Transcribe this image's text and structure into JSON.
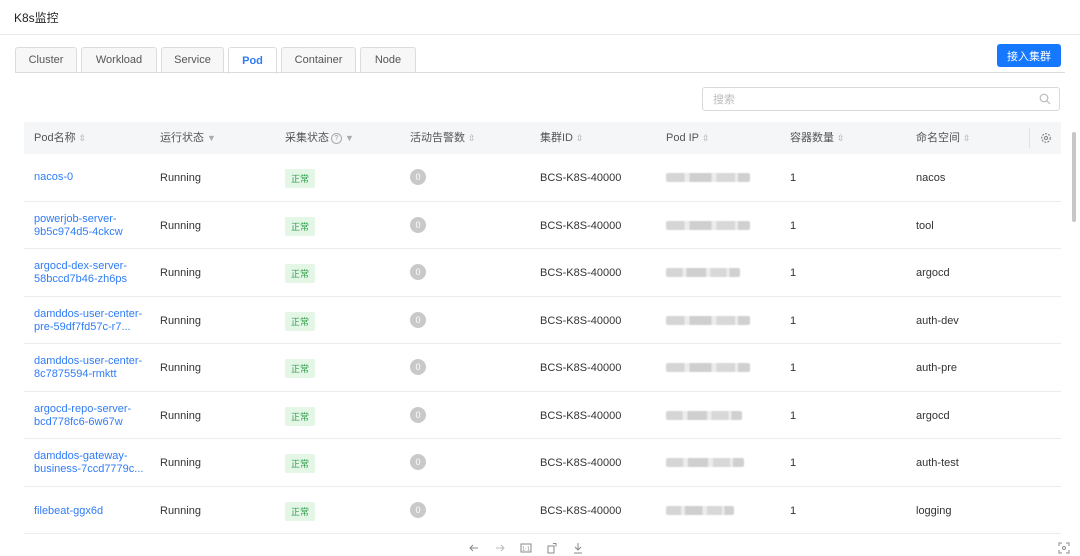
{
  "app": {
    "title": "K8s监控"
  },
  "tabs": [
    {
      "label": "Cluster",
      "active": false
    },
    {
      "label": "Workload",
      "active": false
    },
    {
      "label": "Service",
      "active": false
    },
    {
      "label": "Pod",
      "active": true
    },
    {
      "label": "Container",
      "active": false
    },
    {
      "label": "Node",
      "active": false
    }
  ],
  "actions": {
    "connect_cluster_label": "接入集群"
  },
  "search": {
    "placeholder": "搜索",
    "value": ""
  },
  "table": {
    "columns": {
      "pod_name": "Pod名称",
      "run_status": "运行状态",
      "collect_status": "采集状态",
      "active_alarms": "活动告警数",
      "cluster_id": "集群ID",
      "pod_ip": "Pod IP",
      "container_count": "容器数量",
      "namespace": "命名空间"
    },
    "rows": [
      {
        "name": "nacos-0",
        "status": "Running",
        "collect": "正常",
        "alarms": "0",
        "cluster": "BCS-K8S-40000",
        "containers": "1",
        "namespace": "nacos"
      },
      {
        "name": "powerjob-server-9b5c974d5-4ckcw",
        "status": "Running",
        "collect": "正常",
        "alarms": "0",
        "cluster": "BCS-K8S-40000",
        "containers": "1",
        "namespace": "tool"
      },
      {
        "name": "argocd-dex-server-58bccd7b46-zh6ps",
        "status": "Running",
        "collect": "正常",
        "alarms": "0",
        "cluster": "BCS-K8S-40000",
        "containers": "1",
        "namespace": "argocd"
      },
      {
        "name": "damddos-user-center-pre-59df7fd57c-r7...",
        "status": "Running",
        "collect": "正常",
        "alarms": "0",
        "cluster": "BCS-K8S-40000",
        "containers": "1",
        "namespace": "auth-dev"
      },
      {
        "name": "damddos-user-center-8c7875594-rmktt",
        "status": "Running",
        "collect": "正常",
        "alarms": "0",
        "cluster": "BCS-K8S-40000",
        "containers": "1",
        "namespace": "auth-pre"
      },
      {
        "name": "argocd-repo-server-bcd778fc6-6w67w",
        "status": "Running",
        "collect": "正常",
        "alarms": "0",
        "cluster": "BCS-K8S-40000",
        "containers": "1",
        "namespace": "argocd"
      },
      {
        "name": "damddos-gateway-business-7ccd7779c...",
        "status": "Running",
        "collect": "正常",
        "alarms": "0",
        "cluster": "BCS-K8S-40000",
        "containers": "1",
        "namespace": "auth-test"
      },
      {
        "name": "filebeat-ggx6d",
        "status": "Running",
        "collect": "正常",
        "alarms": "0",
        "cluster": "BCS-K8S-40000",
        "containers": "1",
        "namespace": "logging"
      }
    ]
  },
  "colors": {
    "accent": "#1677ff",
    "link": "#2f7cf6",
    "ok_bg": "#e4f7e7",
    "ok_text": "#2e9e4a"
  },
  "icons": [
    "search-icon",
    "help-icon",
    "settings-icon",
    "arrow-left-icon",
    "arrow-right-icon",
    "actual-size-icon",
    "rotate-icon",
    "download-icon",
    "fullscreen-icon"
  ]
}
